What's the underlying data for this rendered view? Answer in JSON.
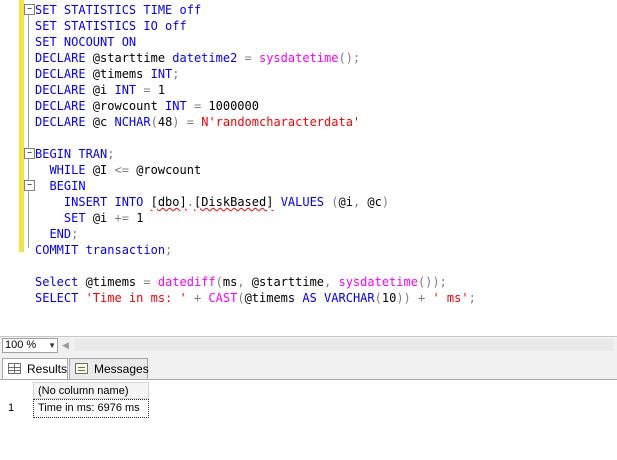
{
  "editor": {
    "lines": [
      {
        "indent": "",
        "tokens": [
          {
            "t": "SET STATISTICS TIME ",
            "c": "kw"
          },
          {
            "t": "off",
            "c": "kw"
          }
        ]
      },
      {
        "indent": "",
        "tokens": [
          {
            "t": "SET STATISTICS IO ",
            "c": "kw"
          },
          {
            "t": "off",
            "c": "kw"
          }
        ]
      },
      {
        "indent": "",
        "tokens": [
          {
            "t": "SET NOCOUNT ON",
            "c": "kw"
          }
        ]
      },
      {
        "indent": "",
        "tokens": [
          {
            "t": "DECLARE ",
            "c": "kw"
          },
          {
            "t": "@starttime ",
            "c": ""
          },
          {
            "t": "datetime2 ",
            "c": "kw"
          },
          {
            "t": "= ",
            "c": "op"
          },
          {
            "t": "sysdatetime",
            "c": "fn"
          },
          {
            "t": "();",
            "c": "op"
          }
        ]
      },
      {
        "indent": "",
        "tokens": [
          {
            "t": "DECLARE ",
            "c": "kw"
          },
          {
            "t": "@timems ",
            "c": ""
          },
          {
            "t": "INT",
            "c": "kw"
          },
          {
            "t": ";",
            "c": "op"
          }
        ]
      },
      {
        "indent": "",
        "tokens": [
          {
            "t": "DECLARE ",
            "c": "kw"
          },
          {
            "t": "@i ",
            "c": ""
          },
          {
            "t": "INT ",
            "c": "kw"
          },
          {
            "t": "= ",
            "c": "op"
          },
          {
            "t": "1",
            "c": ""
          }
        ]
      },
      {
        "indent": "",
        "tokens": [
          {
            "t": "DECLARE ",
            "c": "kw"
          },
          {
            "t": "@rowcount ",
            "c": ""
          },
          {
            "t": "INT ",
            "c": "kw"
          },
          {
            "t": "= ",
            "c": "op"
          },
          {
            "t": "1000000",
            "c": ""
          }
        ]
      },
      {
        "indent": "",
        "tokens": [
          {
            "t": "DECLARE ",
            "c": "kw"
          },
          {
            "t": "@c ",
            "c": ""
          },
          {
            "t": "NCHAR",
            "c": "kw"
          },
          {
            "t": "(",
            "c": "op"
          },
          {
            "t": "48",
            "c": ""
          },
          {
            "t": ") = ",
            "c": "op"
          },
          {
            "t": "N'randomcharacterdata'",
            "c": "str"
          }
        ]
      },
      {
        "indent": "",
        "tokens": []
      },
      {
        "indent": "",
        "tokens": [
          {
            "t": "BEGIN TRAN",
            "c": "kw"
          },
          {
            "t": ";",
            "c": "op"
          }
        ]
      },
      {
        "indent": "  ",
        "tokens": [
          {
            "t": "WHILE ",
            "c": "kw"
          },
          {
            "t": "@I ",
            "c": ""
          },
          {
            "t": "<= ",
            "c": "op"
          },
          {
            "t": "@rowcount",
            "c": ""
          }
        ]
      },
      {
        "indent": "  ",
        "tokens": [
          {
            "t": "BEGIN",
            "c": "kw"
          }
        ]
      },
      {
        "indent": "    ",
        "tokens": [
          {
            "t": "INSERT INTO ",
            "c": "kw"
          },
          {
            "t": "[dbo]",
            "c": "sq"
          },
          {
            "t": ".",
            "c": "op"
          },
          {
            "t": "[DiskBased]",
            "c": "sq"
          },
          {
            "t": " ",
            "c": ""
          },
          {
            "t": "VALUES ",
            "c": "kw"
          },
          {
            "t": "(",
            "c": "op"
          },
          {
            "t": "@i",
            "c": ""
          },
          {
            "t": ", ",
            "c": "op"
          },
          {
            "t": "@c",
            "c": ""
          },
          {
            "t": ")",
            "c": "op"
          }
        ]
      },
      {
        "indent": "    ",
        "tokens": [
          {
            "t": "SET ",
            "c": "kw"
          },
          {
            "t": "@i ",
            "c": ""
          },
          {
            "t": "+= ",
            "c": "op"
          },
          {
            "t": "1",
            "c": ""
          }
        ]
      },
      {
        "indent": "  ",
        "tokens": [
          {
            "t": "END",
            "c": "kw"
          },
          {
            "t": ";",
            "c": "op"
          }
        ]
      },
      {
        "indent": "",
        "tokens": [
          {
            "t": "COMMIT transaction",
            "c": "kw"
          },
          {
            "t": ";",
            "c": "op"
          }
        ]
      },
      {
        "indent": "",
        "tokens": []
      },
      {
        "indent": "",
        "tokens": [
          {
            "t": "Select ",
            "c": "kw"
          },
          {
            "t": "@timems ",
            "c": ""
          },
          {
            "t": "= ",
            "c": "op"
          },
          {
            "t": "datediff",
            "c": "fn"
          },
          {
            "t": "(",
            "c": "op"
          },
          {
            "t": "ms",
            "c": ""
          },
          {
            "t": ", ",
            "c": "op"
          },
          {
            "t": "@starttime",
            "c": ""
          },
          {
            "t": ", ",
            "c": "op"
          },
          {
            "t": "sysdatetime",
            "c": "fn"
          },
          {
            "t": "());",
            "c": "op"
          }
        ]
      },
      {
        "indent": "",
        "tokens": [
          {
            "t": "SELECT ",
            "c": "kw"
          },
          {
            "t": "'Time in ms: '",
            "c": "str"
          },
          {
            "t": " + ",
            "c": "op"
          },
          {
            "t": "CAST",
            "c": "fn"
          },
          {
            "t": "(",
            "c": "op"
          },
          {
            "t": "@timems ",
            "c": ""
          },
          {
            "t": "AS ",
            "c": "kw"
          },
          {
            "t": "VARCHAR",
            "c": "kw"
          },
          {
            "t": "(",
            "c": "op"
          },
          {
            "t": "10",
            "c": ""
          },
          {
            "t": ")) + ",
            "c": "op"
          },
          {
            "t": "' ms'",
            "c": "str"
          },
          {
            "t": ";",
            "c": "op"
          }
        ]
      }
    ],
    "fold_markers": [
      "−",
      "−",
      "−"
    ]
  },
  "status_bar": {
    "zoom": "100 %",
    "zoom_arrow": "▼",
    "scroll_left_arrow": "◀"
  },
  "results": {
    "tabs": [
      {
        "label": "Results",
        "icon": "results-grid-icon",
        "active": true
      },
      {
        "label": "Messages",
        "icon": "messages-icon",
        "active": false
      }
    ],
    "grid": {
      "column_header": "(No column name)",
      "row_number": "1",
      "value": "Time in ms: 6976 ms"
    }
  },
  "colors": {
    "keyword": "#0000ff",
    "function": "#ff00ff",
    "string": "#ff0000",
    "operator": "#808080",
    "change_margin": "#f5e342"
  }
}
